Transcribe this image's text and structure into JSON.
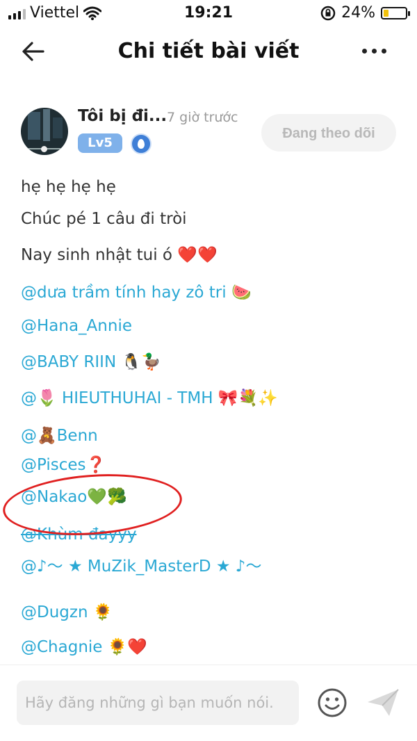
{
  "status_bar": {
    "carrier": "Viettel",
    "time": "19:21",
    "battery": "24%",
    "battery_level": 0.24
  },
  "nav": {
    "title": "Chi tiết bài viết"
  },
  "post": {
    "author": "Tôi bị đi...",
    "time_ago": "7 giờ trước",
    "level": "Lv5",
    "follow_label": "Đang theo dõi",
    "lines": [
      {
        "text": "hẹ hẹ hẹ hẹ",
        "kind": "plain"
      },
      {
        "text": "Chúc pé 1 câu đi tròi",
        "kind": "plain"
      },
      {
        "text": "Nay sinh nhật tui ó ❤️❤️",
        "kind": "plain"
      },
      {
        "text": " @dưa trầm tính hay zô tri 🍉",
        "kind": "mention"
      },
      {
        "text": "@Hana_Annie",
        "kind": "mention"
      },
      {
        "text": "@BABY RIIN 🐧🦆",
        "kind": "mention"
      },
      {
        "text": "@🌷 HIEUTHUHAI - TMH 🎀💐✨",
        "kind": "mention"
      },
      {
        "text": "@🧸Benn",
        "kind": "mention"
      },
      {
        "text": "@Pisces❓",
        "kind": "mention"
      },
      {
        "text": "@Nakao💚🥦",
        "kind": "mention"
      },
      {
        "text": "@Khùm đayyy",
        "kind": "mention"
      },
      {
        "text": "@♪～ ★ MuZik_MasterD ★ ♪～",
        "kind": "mention"
      },
      {
        "text": "@Dugzn 🌻",
        "kind": "mention"
      },
      {
        "text": "@Chagnie 🌻❤️",
        "kind": "mention"
      }
    ]
  },
  "composer": {
    "placeholder": "Hãy đăng những gì bạn muốn nói."
  },
  "icons": {
    "back": "back-arrow-icon",
    "more": "more-dots-icon",
    "emoji": "smiley-icon",
    "send": "send-icon",
    "wifi": "wifi-icon",
    "lock": "rotation-lock-icon"
  },
  "colors": {
    "mention": "#2aa8d4",
    "level_badge": "#7fb1ea",
    "annotation": "#e02020"
  }
}
